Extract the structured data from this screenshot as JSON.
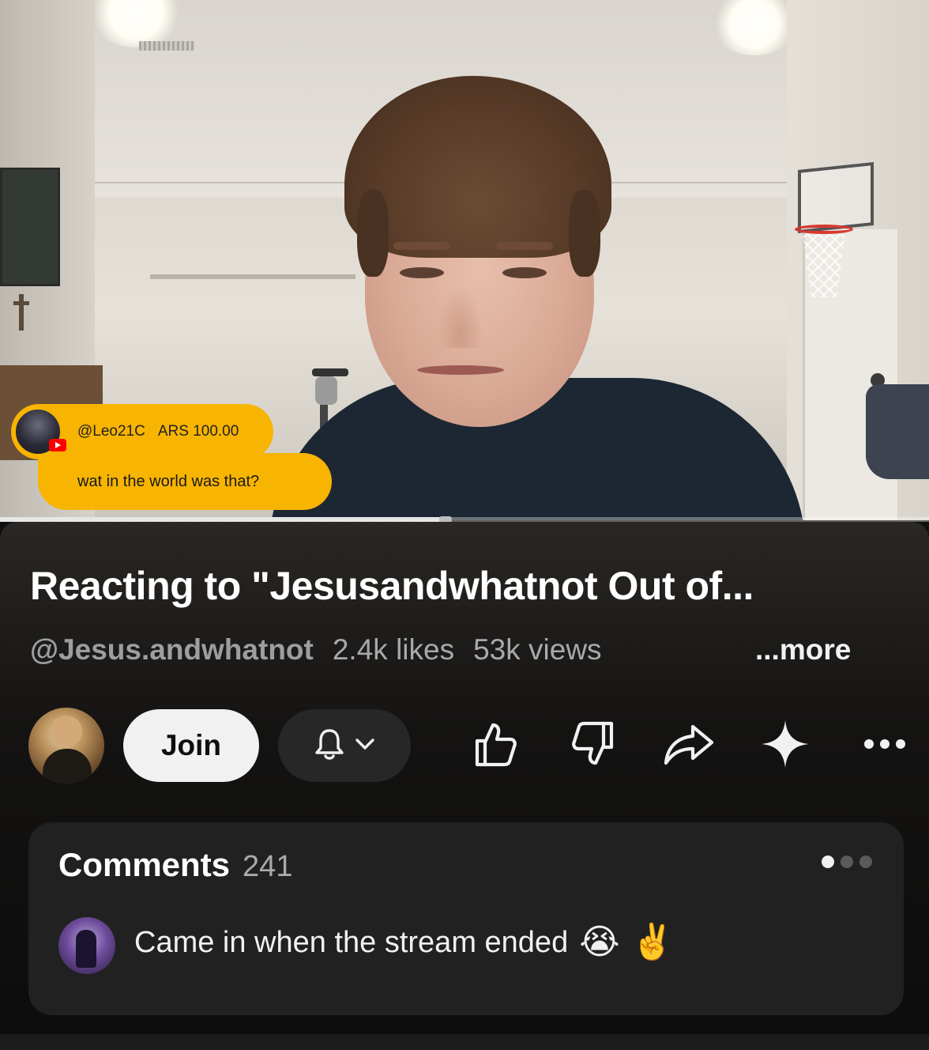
{
  "live_chat": {
    "superchat": {
      "author": "@Leo21C",
      "amount": "ARS 100.00",
      "message": "wat in the world was that?"
    }
  },
  "player": {
    "progress": 0.48
  },
  "video": {
    "title": "Reacting to \"Jesusandwhatnot Out of...",
    "channel_handle": "@Jesus.andwhatnot",
    "likes": "2.4k likes",
    "views": "53k views",
    "more_label": "...more"
  },
  "actions": {
    "join_label": "Join",
    "icons": [
      "bell-icon",
      "chevron-down-icon",
      "thumbs-up-icon",
      "thumbs-down-icon",
      "share-icon",
      "sparkle-icon",
      "more-icon"
    ]
  },
  "comments": {
    "heading": "Comments",
    "count": "241",
    "top_comment": {
      "text": "Came in when the stream ended",
      "emoji_1": "😭",
      "emoji_2": "✌️"
    }
  },
  "colors": {
    "superchat": "#f7b400",
    "panel": "#0f0f0f",
    "comments_card": "#212121",
    "youtube_red": "#ff0000"
  }
}
